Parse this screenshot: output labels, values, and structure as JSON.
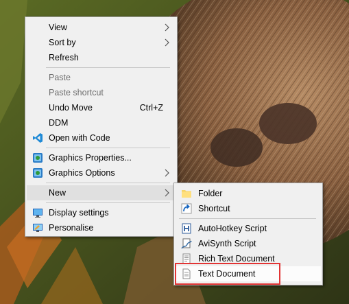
{
  "context_menu": {
    "items": [
      {
        "label": "View",
        "has_submenu": true
      },
      {
        "label": "Sort by",
        "has_submenu": true
      },
      {
        "label": "Refresh"
      },
      {
        "label": "Paste",
        "disabled": true
      },
      {
        "label": "Paste shortcut",
        "disabled": true
      },
      {
        "label": "Undo Move",
        "shortcut": "Ctrl+Z"
      },
      {
        "label": "DDM"
      },
      {
        "label": "Open with Code",
        "icon": "vscode-icon"
      },
      {
        "label": "Graphics Properties...",
        "icon": "intel-graphics-icon"
      },
      {
        "label": "Graphics Options",
        "icon": "intel-graphics-icon",
        "has_submenu": true
      },
      {
        "label": "New",
        "has_submenu": true,
        "state": "open"
      },
      {
        "label": "Display settings",
        "icon": "display-settings-icon"
      },
      {
        "label": "Personalise",
        "icon": "personalise-icon"
      }
    ]
  },
  "new_submenu": {
    "items": [
      {
        "label": "Folder",
        "icon": "folder-icon"
      },
      {
        "label": "Shortcut",
        "icon": "shortcut-icon"
      },
      {
        "label": "AutoHotkey Script",
        "icon": "autohotkey-icon"
      },
      {
        "label": "AviSynth Script",
        "icon": "avisynth-icon"
      },
      {
        "label": "Rich Text Document",
        "icon": "rich-text-icon"
      },
      {
        "label": "Text Document",
        "icon": "text-document-icon",
        "state": "highlighted"
      }
    ]
  },
  "colors": {
    "menu_bg": "#f0f0f0",
    "highlight_border": "#e23434",
    "disabled_text": "#6d6d6d"
  }
}
